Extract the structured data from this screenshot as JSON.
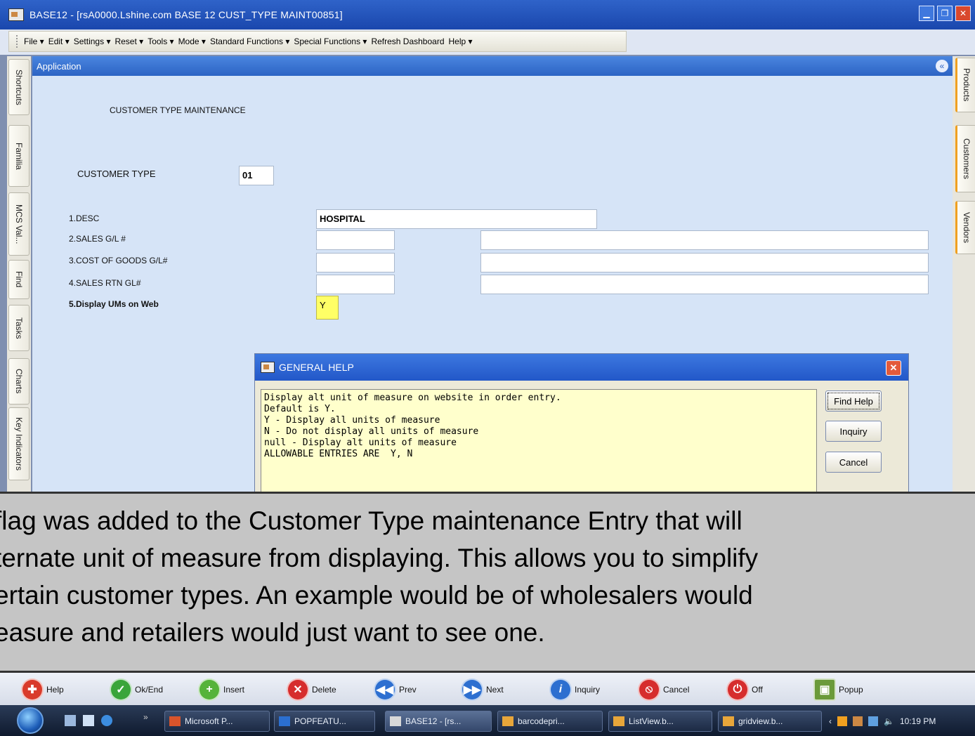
{
  "window": {
    "title": "BASE12 - [rsA0000.Lshine.com BASE 12 CUST_TYPE MAINT00851]"
  },
  "menu": [
    "File ▾",
    "Edit ▾",
    "Settings ▾",
    "Reset ▾",
    "Tools ▾",
    "Mode ▾",
    "Standard Functions ▾",
    "Special Functions ▾",
    "Refresh Dashboard",
    "Help ▾"
  ],
  "left_tabs": [
    "Shortcuts",
    "Familia",
    "MCS Val...",
    "Find",
    "Tasks",
    "Charts",
    "Key Indicators"
  ],
  "right_tabs": [
    "Products",
    "Customers",
    "Vendors"
  ],
  "app": {
    "header": "Application",
    "title": "CUSTOMER TYPE MAINTENANCE",
    "customer_type_label": "CUSTOMER TYPE",
    "customer_type_value": "01",
    "fields": {
      "desc_label": "1.DESC",
      "desc_value": "HOSPITAL",
      "sales_label": "2.SALES G/L #",
      "cogs_label": "3.COST OF GOODS G/L#",
      "rtn_label": "4.SALES RTN GL#",
      "display_label": "5.Display UMs on Web",
      "display_value": "Y"
    }
  },
  "dialog": {
    "title": "GENERAL HELP",
    "lines": [
      "Display alt unit of measure on website in order entry.",
      "Default is Y.",
      "Y - Display all units of measure",
      "N - Do not display all units of measure",
      "null - Display alt units of measure",
      "ALLOWABLE ENTRIES ARE  Y, N"
    ],
    "find_help": "Find Help",
    "inquiry": "Inquiry",
    "cancel": "Cancel"
  },
  "caption": {
    "lines": [
      "flag was added to the Customer Type maintenance Entry that will",
      "ternate unit of measure from displaying. This allows you to simplify",
      "ertain customer types. An example would be  of wholesalers would",
      "easure and retailers would just want to see one."
    ]
  },
  "toolbar": {
    "help": "Help",
    "ok_end": "Ok/End",
    "insert": "Insert",
    "delete": "Delete",
    "prev": "Prev",
    "next": "Next",
    "inquiry": "Inquiry",
    "cancel": "Cancel",
    "off": "Off",
    "popup": "Popup"
  },
  "taskbar": {
    "tasks": [
      "Microsoft P...",
      "POPFEATU...",
      "BASE12 - [rs...",
      "barcodepri...",
      "ListView.b...",
      "gridview.b..."
    ],
    "clock": "10:19 PM"
  },
  "colors": {
    "titlebar": "#1f4fb8",
    "panel_bg": "#d6e4f7",
    "help_bg": "#ffffcc",
    "highlight_field": "#ffff66",
    "caption_bg": "#c5c5c5"
  }
}
